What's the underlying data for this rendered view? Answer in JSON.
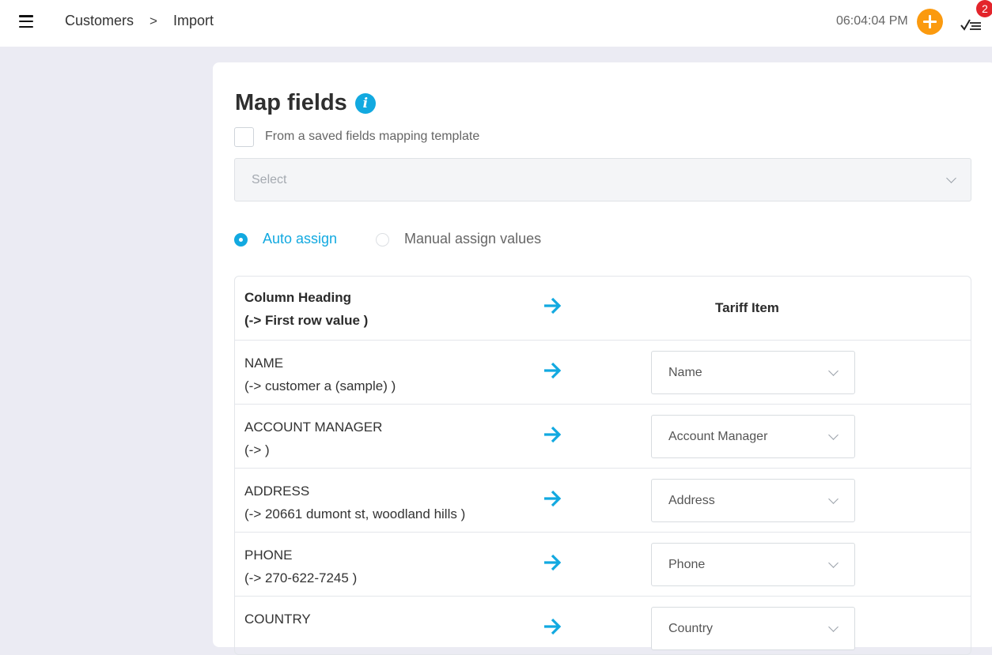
{
  "header": {
    "breadcrumb": [
      "Customers",
      ">",
      "Import"
    ],
    "time": "06:04:04 PM",
    "badge_count": "2",
    "icons": {
      "menu": "hamburger-menu-icon",
      "add": "plus-circle-icon",
      "tasks": "checklist-icon"
    },
    "accent": "#fb9a0f"
  },
  "page": {
    "title": "Map fields",
    "info_icon_glyph": "i",
    "template_checkbox_label": "From a saved fields mapping template",
    "template_select_placeholder": "Select",
    "assign_options": [
      {
        "label": "Auto assign",
        "selected": true
      },
      {
        "label": "Manual assign values",
        "selected": false
      }
    ],
    "accent": "#12a9e0"
  },
  "mapping": {
    "header": {
      "left_line1": "Column Heading",
      "left_line2": "(-> First row value )",
      "right": "Tariff Item"
    },
    "rows": [
      {
        "heading": "NAME",
        "sample": "(-> customer a (sample) )",
        "field": "Name"
      },
      {
        "heading": "ACCOUNT MANAGER",
        "sample": "(-> )",
        "field": "Account Manager"
      },
      {
        "heading": "ADDRESS",
        "sample": "(-> 20661 dumont st, woodland hills )",
        "field": "Address"
      },
      {
        "heading": "PHONE",
        "sample": "(-> 270-622-7245 )",
        "field": "Phone"
      },
      {
        "heading": "COUNTRY",
        "sample": "",
        "field": "Country"
      }
    ]
  }
}
